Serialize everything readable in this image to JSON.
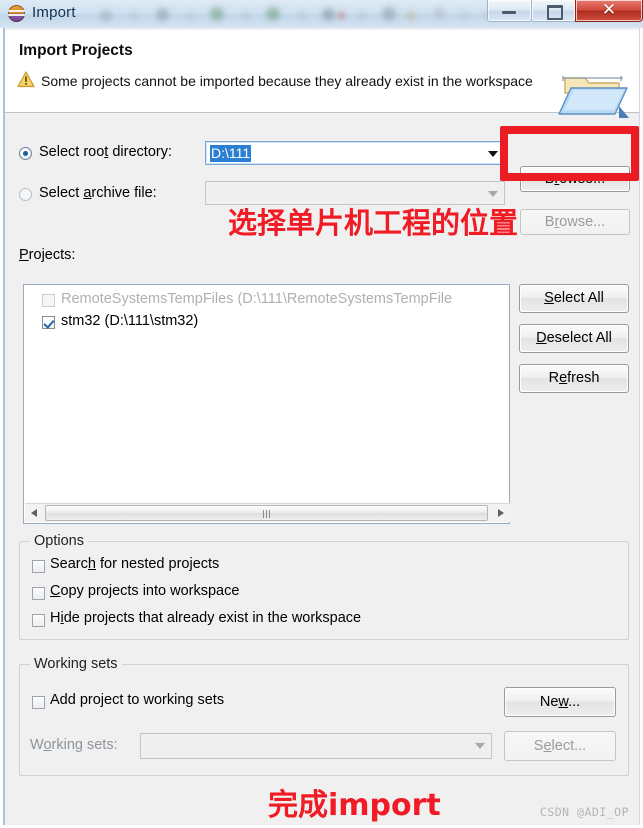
{
  "window": {
    "title": "Import",
    "icon": "eclipse-icon",
    "controls": {
      "minimize": "minimize-icon",
      "maximize": "maximize-icon",
      "close": "✕"
    }
  },
  "header": {
    "title": "Import Projects",
    "message": "Some projects cannot be imported because they already exist in the workspace",
    "warning_icon": "warning-icon",
    "banner_icon": "folder-import-icon"
  },
  "source": {
    "root_directory": {
      "label_prefix": "Select roo",
      "label_underlined": "t",
      "label_suffix": " directory:",
      "label_full": "Select root directory:",
      "selected": true,
      "value": "D:\\111",
      "browse_label": "Browse..."
    },
    "archive_file": {
      "label_full": "Select archive file:",
      "selected": false,
      "value": "",
      "browse_label": "Browse...",
      "disabled": true
    }
  },
  "projects": {
    "label": "Projects:",
    "items": [
      {
        "name": "RemoteSystemsTempFiles (D:\\111\\RemoteSystemsTempFile",
        "checked": false,
        "disabled": true
      },
      {
        "name": "stm32 (D:\\111\\stm32)",
        "checked": true,
        "disabled": false
      }
    ],
    "buttons": [
      {
        "label": "Select All"
      },
      {
        "label": "Deselect All"
      },
      {
        "label": "Refresh"
      }
    ]
  },
  "options": {
    "title": "Options",
    "items": [
      {
        "label": "Search for nested projects",
        "checked": false
      },
      {
        "label": "Copy projects into workspace",
        "checked": false
      },
      {
        "label": "Hide projects that already exist in the workspace",
        "checked": false
      }
    ]
  },
  "working_sets": {
    "title": "Working sets",
    "add_checkbox": {
      "label": "Add project to working sets",
      "checked": false
    },
    "new_button": "New...",
    "select_button": "Select...",
    "combo_label": "Working sets:",
    "combo_value": ""
  },
  "annotations": {
    "top_text": "选择单片机工程的位置",
    "bottom_text": "完成import",
    "box_color": "#ec1c24",
    "text_color": "#f01b24"
  },
  "watermark": "CSDN @ADI_OP"
}
